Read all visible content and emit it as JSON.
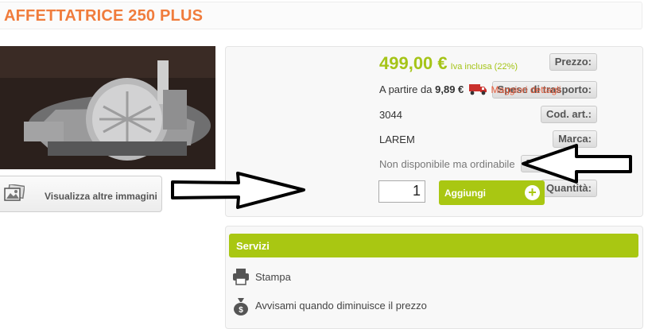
{
  "product": {
    "title": "AFFETTATRICE 250 PLUS",
    "more_images_label": "Visualizza altre immagini"
  },
  "details": {
    "price_label": "Prezzo:",
    "price_value": "499,00 €",
    "vat_note": "Iva inclusa (22%)",
    "shipping_label": "Spese di trasporto:",
    "shipping_prefix": "A partire da",
    "shipping_value": "9,89 €",
    "shipping_link": "Maggiori dettagli",
    "code_label": "Cod. art.:",
    "code_value": "3044",
    "brand_label": "Marca:",
    "brand_value": "LAREM",
    "availability_label": "Disponibilità:",
    "availability_value": "Non disponibile ma ordinabile",
    "quantity_label": "Quantità:",
    "quantity_value": "1",
    "add_button_label": "Aggiungi"
  },
  "services": {
    "header": "Servizi",
    "items": [
      {
        "label": "Stampa",
        "icon": "printer-icon"
      },
      {
        "label": "Avvisami quando diminuisce il prezzo",
        "icon": "money-bag-icon"
      }
    ]
  },
  "colors": {
    "title": "#f07c3c",
    "accent_green": "#a9c712",
    "link_orange": "#e85c3b"
  }
}
